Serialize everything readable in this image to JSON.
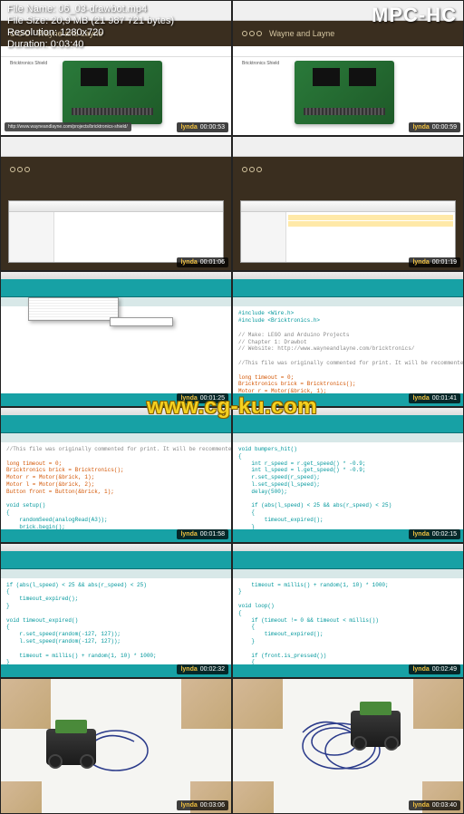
{
  "media_info": {
    "filename_label": "File Name: 06_03-drawbot.mp4",
    "filesize_label": "File Size: 20,9 MB (21 987 721 bytes)",
    "resolution_label": "Resolution: 1280x720",
    "duration_label": "Duration: 0:03:40",
    "player": "MPC-HC"
  },
  "watermark": "www.cg-ku.com",
  "browser": {
    "site_title": "Wayne and Layne",
    "product": "Bricktronics Shield",
    "tooltip_url": "http://www.wayneandlayne.com/projects/bricktronics-shield/"
  },
  "timestamps": {
    "r1l": "00:00:53",
    "r1r": "00:00:59",
    "r2l": "00:01:06",
    "r2r": "00:01:19",
    "r3l": "00:01:25",
    "r3r": "00:01:41",
    "r4l": "00:01:58",
    "r4r": "00:02:15",
    "r5l": "00:02:32",
    "r5r": "00:02:49",
    "r6l": "00:03:06",
    "r6r": "00:03:40"
  },
  "lynda": "lynda",
  "code": {
    "includes": "#include <Wire.h>\n#include <Bricktronics.h>",
    "comment_header": "// Make: LEGO and Arduino Projects\n// Chapter 1: Drawbot\n// Website: http://www.wayneandlayne.com/bricktronics/",
    "comment_inline": "//This file was originally commented for print. It will be recommented inline shortly.",
    "init_block": "long timeout = 0;\nBricktronics brick = Bricktronics();\nMotor r = Motor(&brick, 1);\nMotor l = Motor(&brick, 2);\nButton front = Button(&brick, 1);",
    "setup": "void setup()\n{\n    randomSeed(analogRead(A3));\n    brick.begin();\n    r.begin();\n    l.begin();\n    front.begin();\n}",
    "bumpers": "void bumpers_hit()\n{\n    int r_speed = r.get_speed() * -0.9;\n    int l_speed = l.get_speed() * -0.9;\n    r.set_speed(r_speed);\n    l.set_speed(l_speed);\n    delay(500);\n\n    if (abs(l_speed) < 25 && abs(r_speed) < 25)\n    {\n        timeout_expired();\n    }\n}",
    "expired": "if (abs(l_speed) < 25 && abs(r_speed) < 25)\n{\n    timeout_expired();\n}\n\nvoid timeout_expired()\n{\n    r.set_speed(random(-127, 127));\n    l.set_speed(random(-127, 127));\n\n    timeout = millis() + random(1, 10) * 1000;\n}\n\nvoid loop()\n{",
    "loop": "    timeout = millis() + random(1, 10) * 1000;\n}\n\nvoid loop()\n{\n    if (timeout != 0 && timeout < millis())\n    {\n        timeout_expired();\n    }\n\n    if (front.is_pressed())\n    {\n        bumpers_hit();\n    }\n}"
  }
}
